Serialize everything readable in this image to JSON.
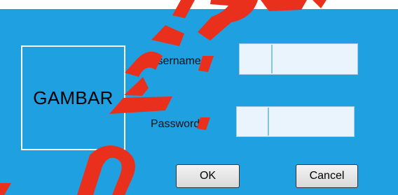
{
  "form": {
    "image_placeholder": "GAMBAR",
    "username_label": "Username",
    "username_value": "",
    "password_label": "Password",
    "password_value": ""
  },
  "buttons": {
    "ok_label": "OK",
    "cancel_label": "Cancel"
  },
  "colors": {
    "background": "#1fa0e0",
    "input_fill": "#e9f4fd",
    "watermark": "#e8301c"
  }
}
